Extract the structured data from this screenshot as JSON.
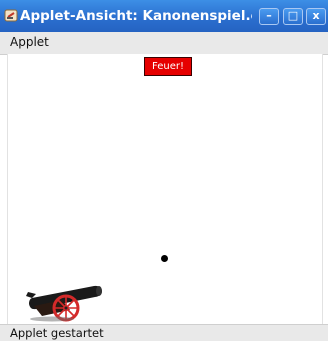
{
  "window": {
    "title": "Applet-Ansicht: Kanonenspiel.class",
    "minimize_glyph": "–",
    "maximize_glyph": "□",
    "close_glyph": "x"
  },
  "menubar": {
    "items": [
      "Applet"
    ]
  },
  "applet": {
    "fire_button_label": "Feuer!"
  },
  "status": {
    "text": "Applet gestartet"
  },
  "colors": {
    "titlebar": "#2b6fcf",
    "fire_button": "#e60000",
    "cannon_barrel": "#1a1a1a",
    "cannon_wheel": "#d42a2a",
    "cannonball": "#000000"
  }
}
